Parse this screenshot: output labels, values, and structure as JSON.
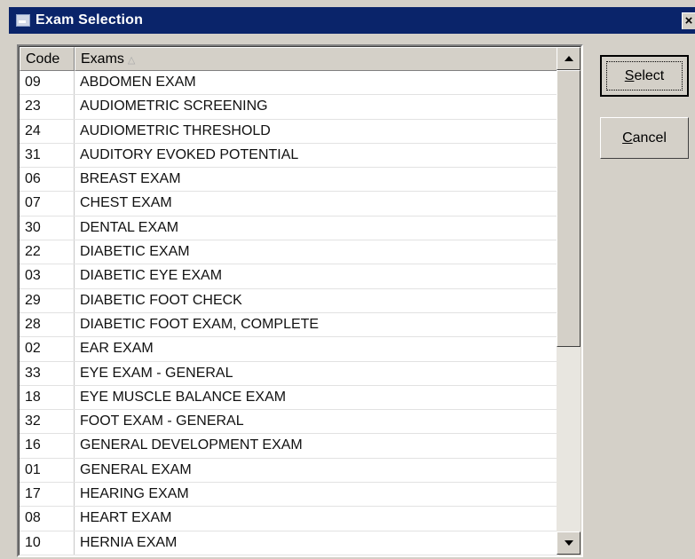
{
  "window": {
    "title": "Exam Selection",
    "close_label": "×"
  },
  "table": {
    "columns": [
      "Code",
      "Exams"
    ],
    "sort_indicator": "△",
    "rows": [
      {
        "code": "09",
        "exam": "ABDOMEN EXAM"
      },
      {
        "code": "23",
        "exam": "AUDIOMETRIC SCREENING"
      },
      {
        "code": "24",
        "exam": "AUDIOMETRIC THRESHOLD"
      },
      {
        "code": "31",
        "exam": "AUDITORY EVOKED POTENTIAL"
      },
      {
        "code": "06",
        "exam": "BREAST EXAM"
      },
      {
        "code": "07",
        "exam": "CHEST EXAM"
      },
      {
        "code": "30",
        "exam": "DENTAL EXAM"
      },
      {
        "code": "22",
        "exam": "DIABETIC EXAM"
      },
      {
        "code": "03",
        "exam": "DIABETIC EYE EXAM"
      },
      {
        "code": "29",
        "exam": "DIABETIC FOOT CHECK"
      },
      {
        "code": "28",
        "exam": "DIABETIC FOOT EXAM, COMPLETE"
      },
      {
        "code": "02",
        "exam": "EAR EXAM"
      },
      {
        "code": "33",
        "exam": "EYE EXAM - GENERAL"
      },
      {
        "code": "18",
        "exam": "EYE MUSCLE BALANCE EXAM"
      },
      {
        "code": "32",
        "exam": "FOOT EXAM - GENERAL"
      },
      {
        "code": "16",
        "exam": "GENERAL DEVELOPMENT EXAM"
      },
      {
        "code": "01",
        "exam": "GENERAL EXAM"
      },
      {
        "code": "17",
        "exam": "HEARING EXAM"
      },
      {
        "code": "08",
        "exam": "HEART EXAM"
      },
      {
        "code": "10",
        "exam": "HERNIA EXAM"
      }
    ]
  },
  "buttons": {
    "select_label": "Select",
    "cancel_label": "Cancel"
  },
  "icons": {
    "title": "app-window-icon",
    "scroll_up": "arrow-up-icon",
    "scroll_down": "arrow-down-icon"
  }
}
